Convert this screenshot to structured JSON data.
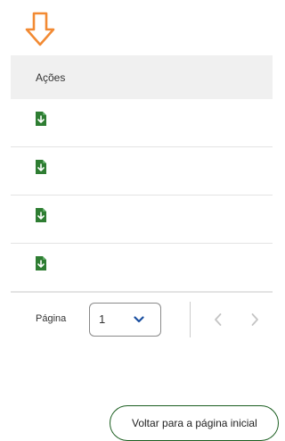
{
  "colors": {
    "accent_orange": "#f28a33",
    "download_green": "#2e7d32",
    "header_bg": "#f0f0f0",
    "button_border": "#1b5e20"
  },
  "table": {
    "header": {
      "actions_label": "Ações"
    },
    "rows": [
      {
        "action_icon": "file-download-icon"
      },
      {
        "action_icon": "file-download-icon"
      },
      {
        "action_icon": "file-download-icon"
      },
      {
        "action_icon": "file-download-icon"
      }
    ]
  },
  "pagination": {
    "page_label": "Página",
    "current_page": "1",
    "prev_icon": "chevron-left-icon",
    "next_icon": "chevron-right-icon"
  },
  "footer": {
    "back_button_label": "Voltar para a página inicial"
  }
}
